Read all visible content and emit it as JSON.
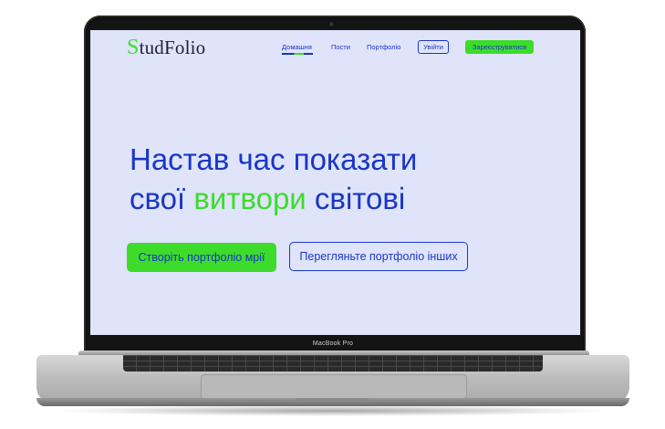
{
  "site": {
    "logo_initial": "S",
    "logo_rest": "tudFolio",
    "nav": {
      "home": "Домашня",
      "posts": "Пости",
      "portfolio": "Портфоліо"
    },
    "login_label": "Увійти",
    "register_label": "Зареєструватися"
  },
  "hero": {
    "line1": "Настав час показати",
    "line2_before": "свої",
    "line2_accent": "витвори",
    "line2_after": "світові",
    "primary_cta": "Створіть портфоліо мрії",
    "secondary_cta": "Перегляньте портфоліо інших"
  },
  "device": {
    "model_label": "MacBook Pro"
  },
  "colors": {
    "brand_blue": "#1a36c4",
    "brand_green": "#3ddc2b",
    "screen_background": "#dfe4fb"
  }
}
